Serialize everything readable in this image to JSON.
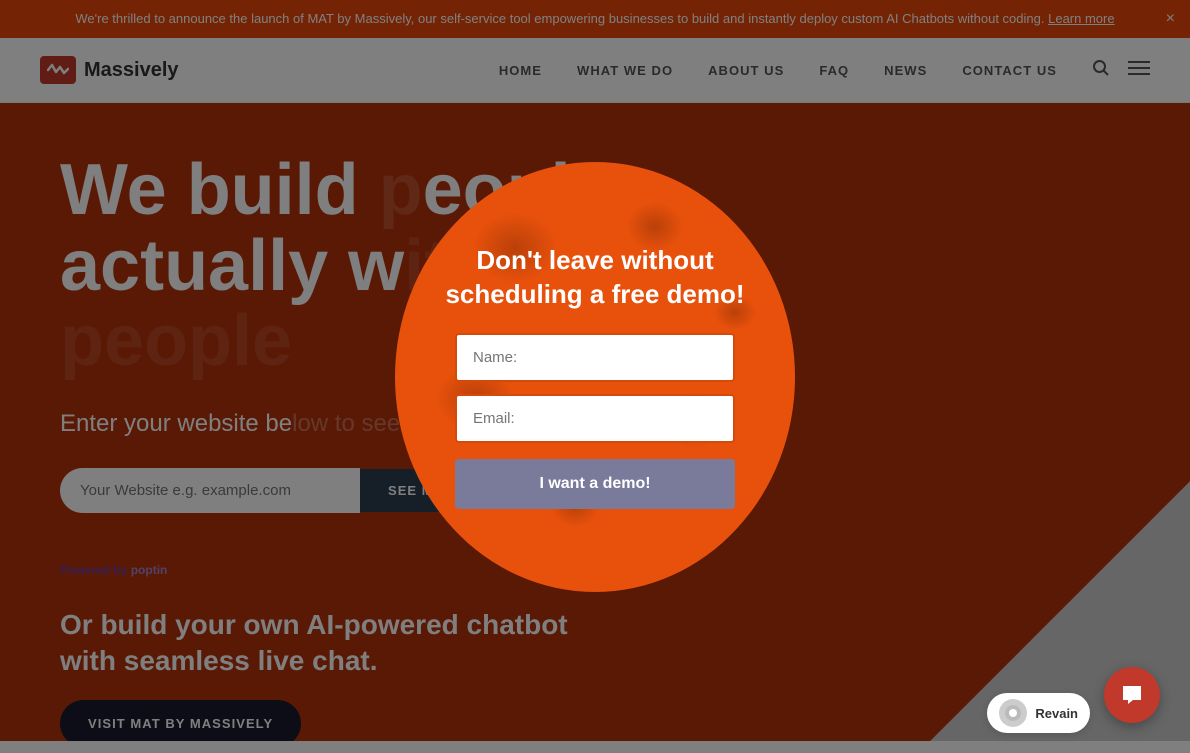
{
  "banner": {
    "text": "We're thrilled to announce the launch of MAT by Massively, our self-service tool empowering businesses to build and instantly deploy custom AI Chatbots without coding.",
    "link_text": "Learn more",
    "close_label": "×"
  },
  "header": {
    "logo_text": "Massively",
    "nav": {
      "home": "HOME",
      "what_we_do": "WHAT WE DO",
      "about_us": "ABOUT US",
      "faq": "FAQ",
      "news": "NEWS",
      "contact_us": "CONTACT US"
    }
  },
  "hero": {
    "title": "We build people actually w",
    "title_part2": "eople",
    "subtitle": "Enter your website be",
    "input_placeholder": "Your Website e.g. example.com",
    "input_btn": "SEE M",
    "secondary_title": "Or build your own AI-powered chatbot\nwith seamless live chat.",
    "cta_btn": "VISIT MAT BY MASSIVELY",
    "powered_by": "Powered by",
    "powered_brand": "poptin"
  },
  "modal": {
    "title": "Don't leave without\nscheduling a free demo!",
    "name_placeholder": "Name:",
    "email_placeholder": "Email:",
    "submit_label": "I want a demo!",
    "close_label": "×"
  },
  "chat": {
    "icon": "💬"
  },
  "revain": {
    "text": "Revain"
  }
}
